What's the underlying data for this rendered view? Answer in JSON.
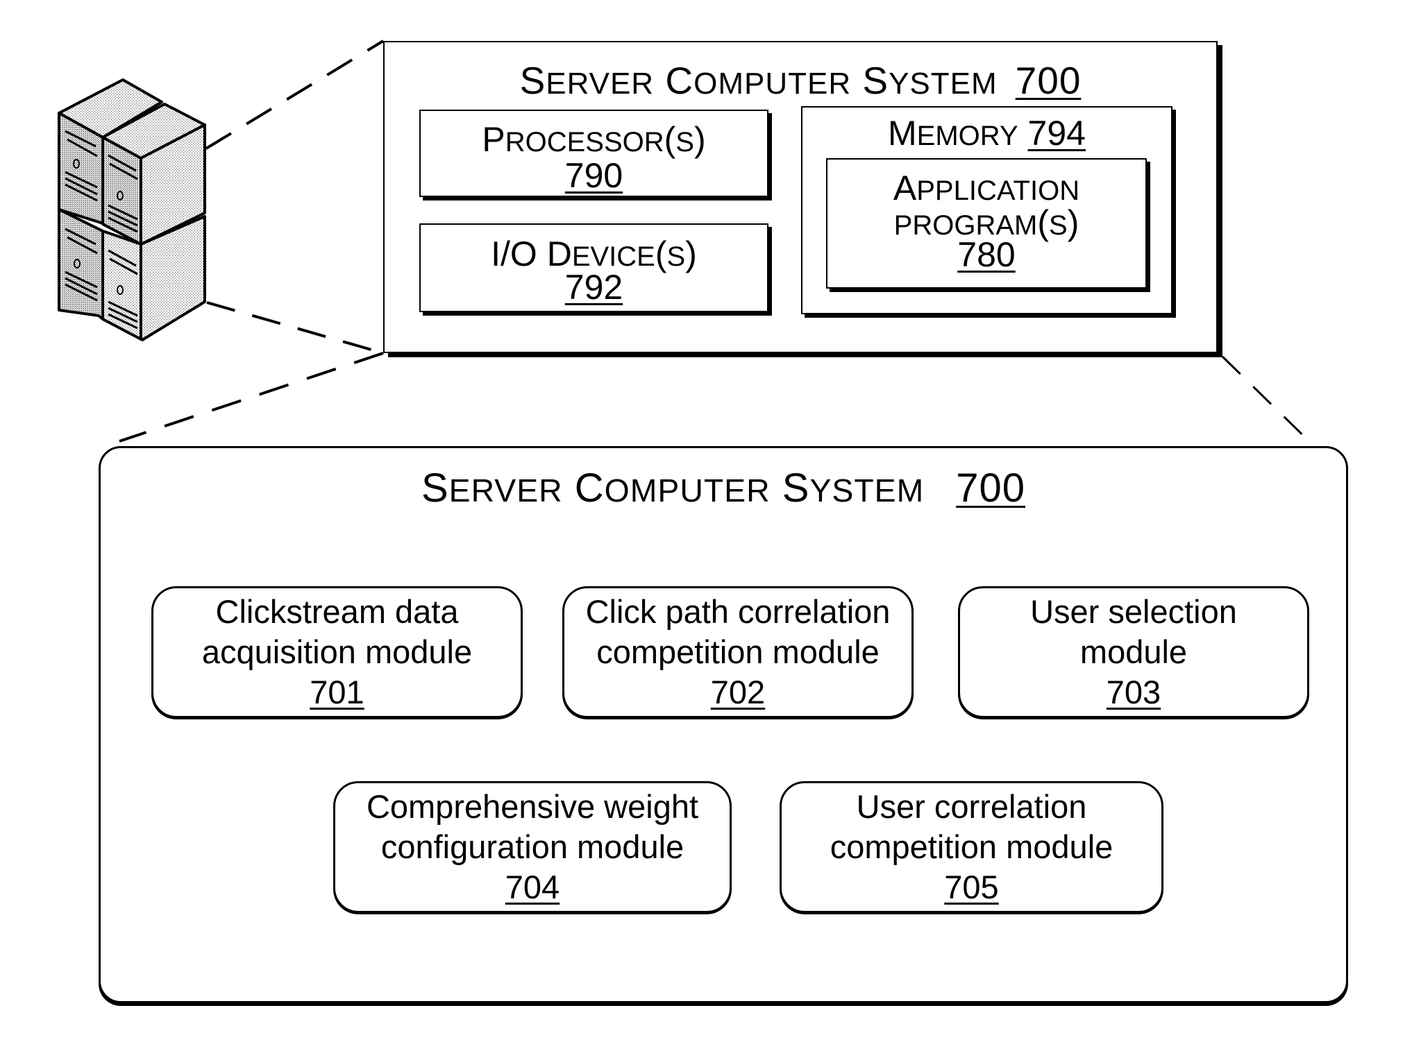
{
  "server_icon": {
    "label": "server-rack-icon"
  },
  "top_panel": {
    "title_first": "S",
    "title_rest": "ERVER",
    "title_word2_first": "C",
    "title_word2_rest": "OMPUTER",
    "title_word3_first": "S",
    "title_word3_rest": "YSTEM",
    "ref": "700",
    "processor": {
      "first": "P",
      "rest": "ROCESSOR",
      "suffix_open": "(",
      "suffix_s": "S",
      "suffix_close": ")",
      "ref": "790"
    },
    "io_device": {
      "first": "I/O D",
      "rest": "EVICE",
      "suffix_open": "(",
      "suffix_s": "S",
      "suffix_close": ")",
      "ref": "792"
    },
    "memory": {
      "first": "M",
      "rest": "EMORY",
      "ref": "794"
    },
    "application": {
      "line1_first": "A",
      "line1_rest": "PPLICATION",
      "line2": "PROGRAM",
      "suffix_open": "(",
      "suffix_s": "S",
      "suffix_close": ")",
      "ref": "780"
    }
  },
  "bottom_panel": {
    "title_first": "S",
    "title_rest": "ERVER",
    "title_word2_first": "C",
    "title_word2_rest": "OMPUTER",
    "title_word3_first": "S",
    "title_word3_rest": "YSTEM",
    "ref": "700",
    "modules": [
      {
        "line1": "Clickstream data",
        "line2": "acquisition module",
        "ref": "701"
      },
      {
        "line1": "Click path correlation",
        "line2": "competition module",
        "ref": "702"
      },
      {
        "line1": "User selection",
        "line2": "module",
        "ref": "703"
      },
      {
        "line1": "Comprehensive weight",
        "line2": "configuration module",
        "ref": "704"
      },
      {
        "line1": "User correlation",
        "line2": "competition module",
        "ref": "705"
      }
    ]
  }
}
